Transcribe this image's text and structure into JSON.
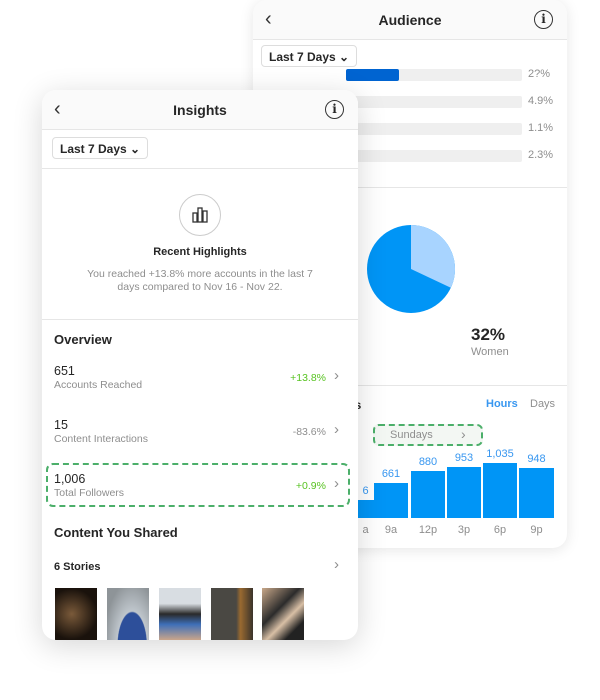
{
  "audience": {
    "title": "Audience",
    "range": "Last 7 Days",
    "age_rows": [
      {
        "value": "2?%",
        "fill": 0.3
      },
      {
        "value": "4.9%",
        "fill": 0
      },
      {
        "value": "1.1%",
        "fill": 0
      },
      {
        "value": "2.3%",
        "fill": 0
      }
    ],
    "gender": {
      "women_percent": 32,
      "label_pct": "32%",
      "label": "Women",
      "colors": {
        "women": "#a8d4ff",
        "men": "#0095f6"
      }
    },
    "times": {
      "title_fragment": "es",
      "tab_hours": "Hours",
      "tab_days": "Days",
      "day_selector": "Sundays"
    },
    "chart_data": {
      "type": "bar",
      "categories": [
        "a",
        "9a",
        "12p",
        "3p",
        "6p",
        "9p"
      ],
      "labels": [
        "6",
        "661",
        "880",
        "953",
        "1,035",
        "948"
      ],
      "values": [
        340,
        661,
        880,
        953,
        1035,
        948
      ],
      "color": "#0095f6"
    }
  },
  "insights": {
    "title": "Insights",
    "range": "Last 7 Days",
    "highlight_title": "Recent Highlights",
    "highlight_text_1": "You reached +13.8% more accounts in the last 7",
    "highlight_text_2": "days compared to Nov 16 - Nov 22.",
    "overview_title": "Overview",
    "rows": [
      {
        "value": "651",
        "label": "Accounts Reached",
        "change": "+13.8%",
        "positive": true
      },
      {
        "value": "15",
        "label": "Content Interactions",
        "change": "-83.6%",
        "positive": false
      },
      {
        "value": "1,006",
        "label": "Total Followers",
        "change": "+0.9%",
        "positive": true
      }
    ],
    "content_title": "Content You Shared",
    "stories_label": "6 Stories"
  },
  "colors": {
    "accent": "#0095f6",
    "positive": "#58c322",
    "highlight_box": "#4caf6a"
  }
}
